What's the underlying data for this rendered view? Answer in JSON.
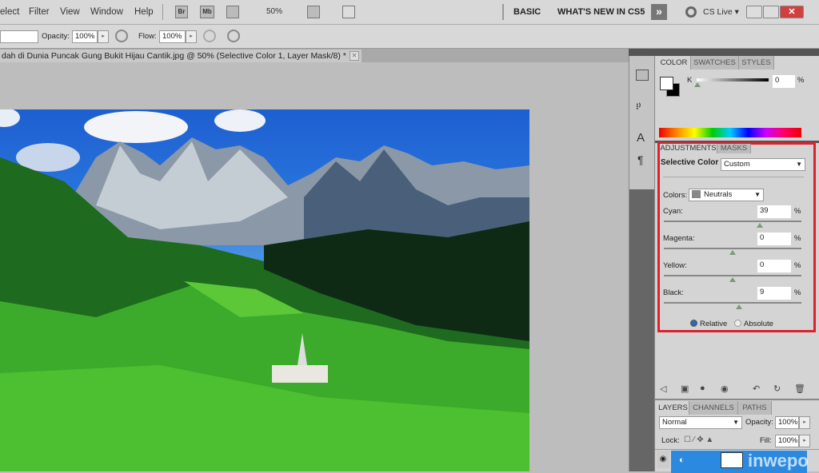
{
  "menu": {
    "items": [
      "elect",
      "Filter",
      "View",
      "Window",
      "Help"
    ],
    "zoom": "50%",
    "br": "Br",
    "mb": "Mb",
    "workspaces": [
      "BASIC",
      "WHAT'S NEW IN CS5"
    ],
    "more": "»",
    "cslive": "CS Live ▾"
  },
  "options": {
    "opacity_label": "Opacity:",
    "opacity": "100%",
    "flow_label": "Flow:",
    "flow": "100%"
  },
  "document": {
    "tab_title": "dah  di Dunia Puncak Gung Bukit Hijau Cantik.jpg @ 50% (Selective Color 1, Layer Mask/8) *",
    "close": "✕"
  },
  "color_panel": {
    "tabs": [
      "COLOR",
      "SWATCHES",
      "STYLES"
    ],
    "channel": "K",
    "value": "0",
    "unit": "%"
  },
  "adjustments": {
    "tabs": [
      "ADJUSTMENTS",
      "MASKS"
    ],
    "title": "Selective Color",
    "preset": "Custom",
    "colors_label": "Colors:",
    "colors_value": "Neutrals",
    "sliders": [
      {
        "label": "Cyan:",
        "value": "39",
        "num": 39
      },
      {
        "label": "Magenta:",
        "value": "0",
        "num": 0
      },
      {
        "label": "Yellow:",
        "value": "0",
        "num": 0
      },
      {
        "label": "Black:",
        "value": "9",
        "num": 9
      }
    ],
    "unit": "%",
    "methods": [
      "Relative",
      "Absolute"
    ],
    "selected_method": "Relative",
    "highlight_color": "#e0202a"
  },
  "layers": {
    "tabs": [
      "LAYERS",
      "CHANNELS",
      "PATHS"
    ],
    "blend": "Normal",
    "opacity_label": "Opacity:",
    "opacity": "100%",
    "lock_label": "Lock:",
    "fill_label": "Fill:",
    "fill": "100%"
  },
  "watermark": "inwepo"
}
